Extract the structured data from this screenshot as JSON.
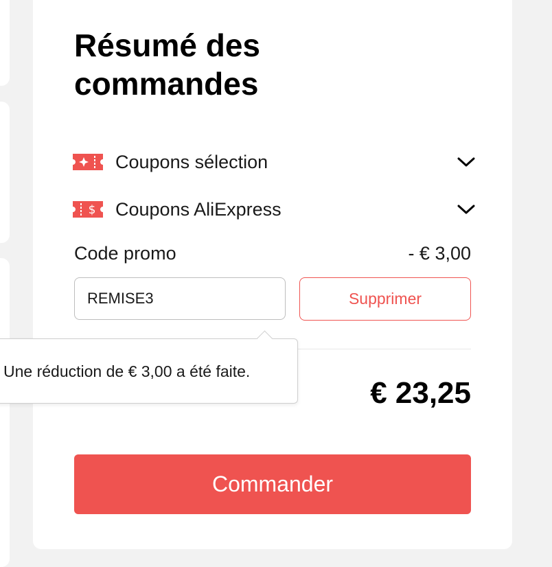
{
  "summary": {
    "title": "Résumé des commandes",
    "coupon_rows": [
      {
        "label": "Coupons sélection",
        "icon": "sparkle-ticket-icon"
      },
      {
        "label": "Coupons AliExpress",
        "icon": "dollar-ticket-icon"
      }
    ],
    "promo": {
      "label": "Code promo",
      "discount": "- € 3,00",
      "input_value": "REMISE3",
      "remove_label": "Supprimer"
    },
    "tooltip": "Une réduction de € 3,00 a été faite.",
    "total": "€ 23,25",
    "checkout_label": "Commander"
  },
  "colors": {
    "accent": "#ef5350",
    "page_bg": "#f2f2f2",
    "card_bg": "#ffffff"
  }
}
